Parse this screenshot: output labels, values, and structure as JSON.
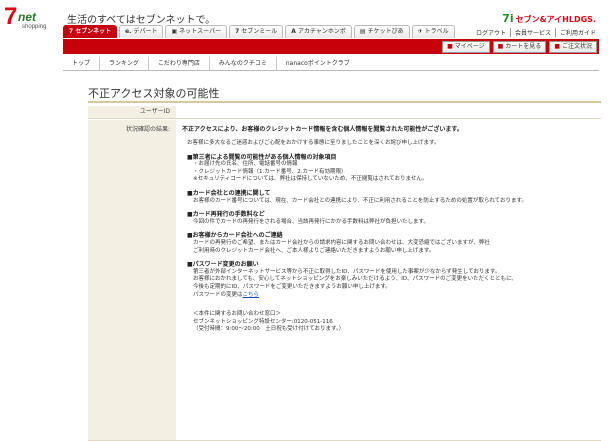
{
  "header": {
    "logo_7": "7",
    "logo_net": "net",
    "logo_shop": "shopping",
    "tagline": "生活のすべてはセブンネットで。",
    "brand_mark": "7i",
    "brand_text": "セブン&アイHLDGS."
  },
  "tabs": [
    {
      "icon": "7",
      "label": "セブンネット"
    },
    {
      "icon": "e.",
      "label": "デパート"
    },
    {
      "icon": "▣",
      "label": "ネットスーパー"
    },
    {
      "icon": "7",
      "label": "セブンミール"
    },
    {
      "icon": "A",
      "label": "アカチャンホンポ"
    },
    {
      "icon": "▤",
      "label": "チケットぴあ"
    },
    {
      "icon": "✈",
      "label": "トラベル"
    }
  ],
  "top_links": [
    "ログアウト",
    "会員サービス",
    "ご利用ガイド"
  ],
  "actions": [
    {
      "icon": "■",
      "label": "マイページ"
    },
    {
      "icon": "■",
      "label": "カートを見る"
    },
    {
      "icon": "■",
      "label": "ご注文状況"
    }
  ],
  "subnav": [
    "トップ",
    "ランキング",
    "こだわり専門店",
    "みんなのクチコミ",
    "nanacoポイントクラブ"
  ],
  "page": {
    "title": "不正アクセス対象の可能性",
    "user_id_label": "ユーザーID",
    "user_id_value": "",
    "status_label": "状況確認の結果:",
    "status_value": "不正アクセスにより、お客様のクレジットカード情報を含む個人情報を閲覧された可能性がございます。"
  },
  "content": {
    "intro": "お客様に多大なるご迷惑およびご心配をおかけする事態に至りましたことを深くお詫び申し上げます。",
    "s1_title": "■第三者による閲覧の可能性がある個人情報の対象項目",
    "s1_items": [
      "・お届け先の氏名、住所、電話番号の情報",
      "・クレジットカード情報（1.カード番号、2.カード有効期限）",
      "※セキュリティコードについては、弊社は保持していないため、不正閲覧はされておりません。"
    ],
    "s2_title": "■カード会社との連携に関して",
    "s2_text": "お客様のカード番号については、現在、カード会社との連携により、不正に利用されることを防止するための処置が取られております。",
    "s3_title": "■カード再発行の手数料など",
    "s3_text": "今回の件でカードの再発行をされる場合、当該再発行にかかる手数料は弊社が負担いたします。",
    "s4_title": "■お客様からカード会社へのご連絡",
    "s4_text1": "カードの再発行のご希望、またはカード会社からの請求内容に関するお問い合わせは、大変恐縮ではございますが、弊社",
    "s4_text2": "ご利用時のクレジットカード会社へ、ご本人様よりご連絡いただきますようお願い申し上げます。",
    "s5_title": "■パスワード変更のお願い",
    "s5_text1": "第三者が外部インターネットサービス等から不正に取得したID、パスワードを使用した事案が少なからず発生しております。",
    "s5_text2": "お客様におかれましても、安心してネットショッピングをお楽しみいただけるよう、ID、パスワードのご変更をいただくとともに、",
    "s5_text3": "今後も定期的にID、パスワードをご変更いただきますようお願い申し上げます。",
    "s5_text4": "パスワードの変更は",
    "s5_link": "こちら",
    "contact_title": "＜本件に関するお問い合わせ窓口＞",
    "contact_line1": "セブンネットショッピング特設センター:0120-051-116",
    "contact_line2": "（受付時間：9:00～20:00　土日祝も受け付けております。）"
  }
}
